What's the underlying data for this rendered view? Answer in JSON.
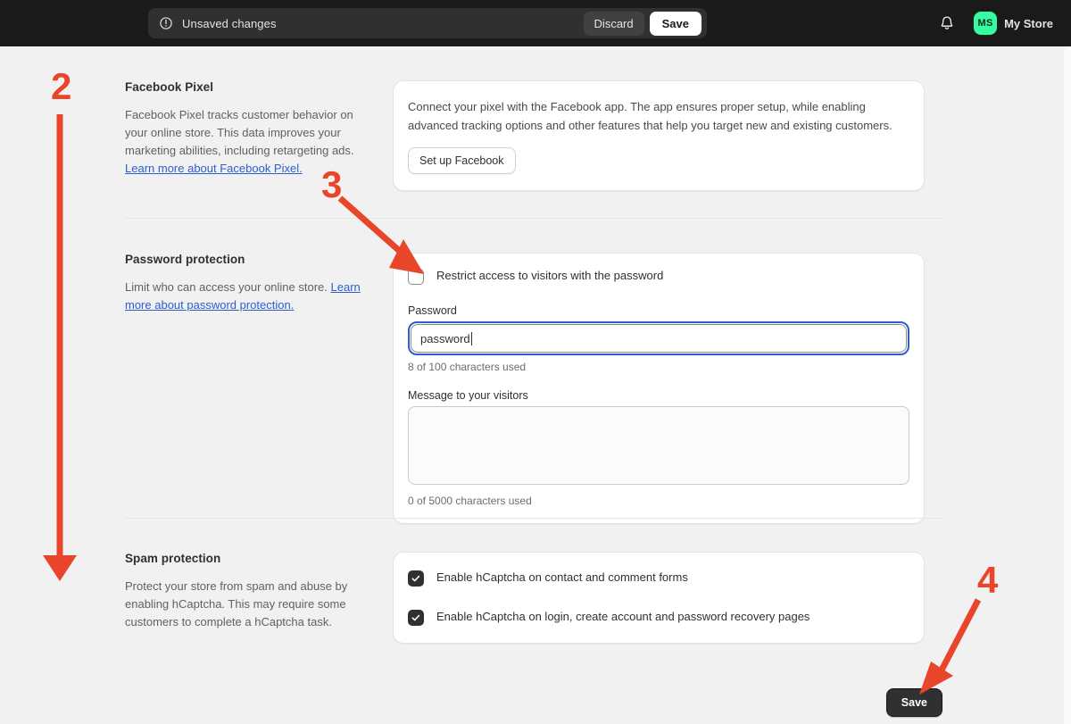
{
  "topbar": {
    "warning_icon": "exclamation-circle-icon",
    "unsaved_label": "Unsaved changes",
    "discard_label": "Discard",
    "save_label": "Save",
    "bell_icon": "notification-bell-icon",
    "avatar_initials": "MS",
    "store_name": "My Store",
    "avatar_color": "#36fba1"
  },
  "sections": {
    "facebook_pixel": {
      "title": "Facebook Pixel",
      "desc": "Facebook Pixel tracks customer behavior on your online store. This data improves your marketing abilities, including retargeting ads. ",
      "link": "Learn more about Facebook Pixel.",
      "card_text": "Connect your pixel with the Facebook app. The app ensures proper setup, while enabling advanced tracking options and other features that help you target new and existing customers.",
      "button": "Set up Facebook"
    },
    "password_protection": {
      "title": "Password protection",
      "desc": "Limit who can access your online store. ",
      "link": "Learn more about password protection.",
      "restrict_checkbox": {
        "label": "Restrict access to visitors with the password",
        "checked": false
      },
      "password_field": {
        "label": "Password",
        "value": "password",
        "hint": "8 of 100 characters used",
        "focused": true
      },
      "message_field": {
        "label": "Message to your visitors",
        "value": "",
        "placeholder": "",
        "hint": "0 of 5000 characters used"
      }
    },
    "spam_protection": {
      "title": "Spam protection",
      "desc": "Protect your store from spam and abuse by enabling hCaptcha. This may require some customers to complete a hCaptcha task.",
      "checkboxes": [
        {
          "label": "Enable hCaptcha on contact and comment forms",
          "checked": true
        },
        {
          "label": "Enable hCaptcha on login, create account and password recovery pages",
          "checked": true
        }
      ]
    }
  },
  "footer": {
    "save_label": "Save"
  },
  "annotations": {
    "color": "#e8452a",
    "items": [
      {
        "number": "2",
        "kind": "long-down-arrow"
      },
      {
        "number": "3",
        "kind": "diagonal-arrow-to-checkbox"
      },
      {
        "number": "4",
        "kind": "diagonal-arrow-to-save"
      }
    ]
  }
}
